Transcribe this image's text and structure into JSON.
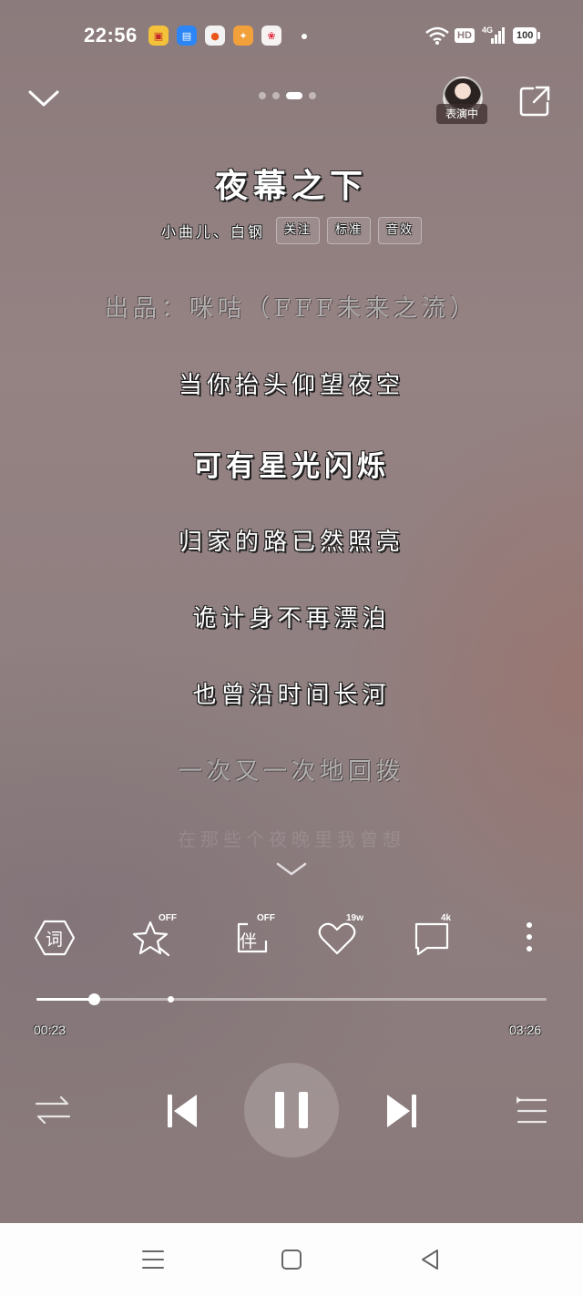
{
  "status_bar": {
    "time": "22:56",
    "network": "4G",
    "hd_label": "HD",
    "battery": "100"
  },
  "header": {
    "page_count": 4,
    "active_page": 3,
    "avatar_tag": "表演中"
  },
  "song": {
    "title": "夜幕之下",
    "artists": "小曲儿、白钢",
    "chips": [
      "关注",
      "标准",
      "音效"
    ]
  },
  "lyrics": {
    "credit": "出品：咪咕（FFF未来之流）",
    "line_before": "当你抬头仰望夜空",
    "current": "可有星光闪烁",
    "next_lines": [
      "归家的路已然照亮",
      "诡计身不再漂泊",
      "也曾沿时间长河",
      "一次又一次地回拨"
    ],
    "faded_line": "在那些个夜晚里我曾想"
  },
  "actions": {
    "lyrics_label": "词",
    "favorite_badge": "OFF",
    "companion_label": "伴",
    "companion_badge": "OFF",
    "like_count": "19w",
    "comment_count": "4k"
  },
  "progress": {
    "elapsed": "00:23",
    "total": "03:26",
    "played_fraction": 0.112,
    "marker_fraction": 0.263
  },
  "colors": {
    "background": "#8d7d7e",
    "accent": "#ffffff",
    "nav_bar": "#fdfdfd"
  }
}
